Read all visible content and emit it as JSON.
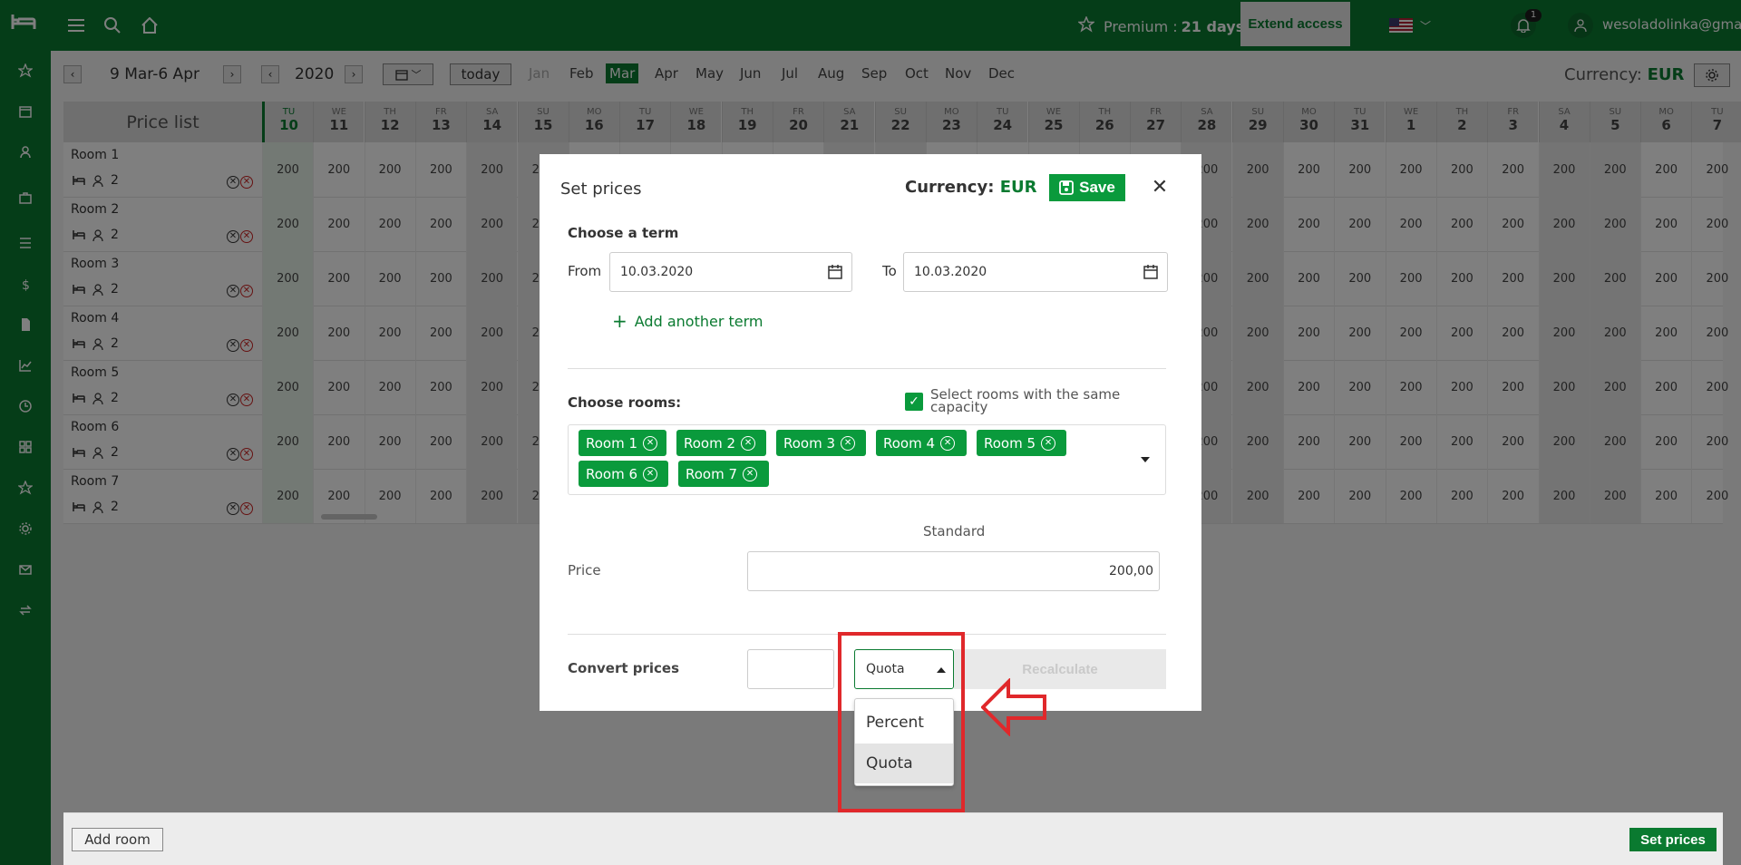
{
  "topbar": {
    "premium_label": "Premium :",
    "premium_days": "21 days",
    "extend_label": "Extend access",
    "notifications_count": "1",
    "user_email": "wesoladolinka@gmail.com"
  },
  "nav": {
    "range": "9 Mar-6 Apr",
    "year": "2020",
    "today_label": "today",
    "months": [
      "Jan",
      "Feb",
      "Mar",
      "Apr",
      "May",
      "Jun",
      "Jul",
      "Aug",
      "Sep",
      "Oct",
      "Nov",
      "Dec"
    ],
    "currency_label": "Currency:",
    "currency_value": "EUR"
  },
  "grid": {
    "title": "Price list",
    "days": [
      {
        "dn": "TU",
        "dd": "10"
      },
      {
        "dn": "WE",
        "dd": "11"
      },
      {
        "dn": "TH",
        "dd": "12"
      },
      {
        "dn": "FR",
        "dd": "13"
      },
      {
        "dn": "SA",
        "dd": "14"
      },
      {
        "dn": "SU",
        "dd": "15"
      },
      {
        "dn": "MO",
        "dd": "16"
      },
      {
        "dn": "TU",
        "dd": "17"
      },
      {
        "dn": "WE",
        "dd": "18"
      },
      {
        "dn": "TH",
        "dd": "19"
      },
      {
        "dn": "FR",
        "dd": "20"
      },
      {
        "dn": "SA",
        "dd": "21"
      },
      {
        "dn": "SU",
        "dd": "22"
      },
      {
        "dn": "MO",
        "dd": "23"
      },
      {
        "dn": "TU",
        "dd": "24"
      },
      {
        "dn": "WE",
        "dd": "25"
      },
      {
        "dn": "TH",
        "dd": "26"
      },
      {
        "dn": "FR",
        "dd": "27"
      },
      {
        "dn": "SA",
        "dd": "28"
      },
      {
        "dn": "SU",
        "dd": "29"
      },
      {
        "dn": "MO",
        "dd": "30"
      },
      {
        "dn": "TU",
        "dd": "31"
      },
      {
        "dn": "WE",
        "dd": "1"
      },
      {
        "dn": "TH",
        "dd": "2"
      },
      {
        "dn": "FR",
        "dd": "3"
      },
      {
        "dn": "SA",
        "dd": "4"
      },
      {
        "dn": "SU",
        "dd": "5"
      },
      {
        "dn": "MO",
        "dd": "6"
      },
      {
        "dn": "TU",
        "dd": "7"
      }
    ],
    "rooms": [
      {
        "name": "Room 1",
        "capacity": "2"
      },
      {
        "name": "Room 2",
        "capacity": "2"
      },
      {
        "name": "Room 3",
        "capacity": "2"
      },
      {
        "name": "Room 4",
        "capacity": "2"
      },
      {
        "name": "Room 5",
        "capacity": "2"
      },
      {
        "name": "Room 6",
        "capacity": "2"
      },
      {
        "name": "Room 7",
        "capacity": "2"
      }
    ],
    "cell_value": "200"
  },
  "modal": {
    "title": "Set prices",
    "currency_label": "Currency:",
    "currency_value": "EUR",
    "save_label": "Save",
    "choose_term": "Choose a term",
    "from_label": "From",
    "from_value": "10.03.2020",
    "to_label": "To",
    "to_value": "10.03.2020",
    "add_term": "Add another term",
    "choose_rooms": "Choose rooms:",
    "same_capacity": "Select rooms with the same capacity",
    "same_capacity_checked": true,
    "selected_rooms": [
      "Room 1",
      "Room 2",
      "Room 3",
      "Room 4",
      "Room 5",
      "Room 6",
      "Room 7"
    ],
    "standard_label": "Standard",
    "price_label": "Price",
    "price_value": "200,00",
    "convert_label": "Convert prices",
    "convert_value": "",
    "convert_mode": "Quota",
    "recalculate_label": "Recalculate",
    "dropdown_options": [
      "Percent",
      "Quota"
    ],
    "dropdown_selected": "Quota"
  },
  "bottom": {
    "add_room_label": "Add room",
    "set_prices_label": "Set prices"
  },
  "colors": {
    "brand_green": "#0a7a30",
    "chip_green": "#0a9a3c",
    "annotation_red": "#e0282b"
  }
}
